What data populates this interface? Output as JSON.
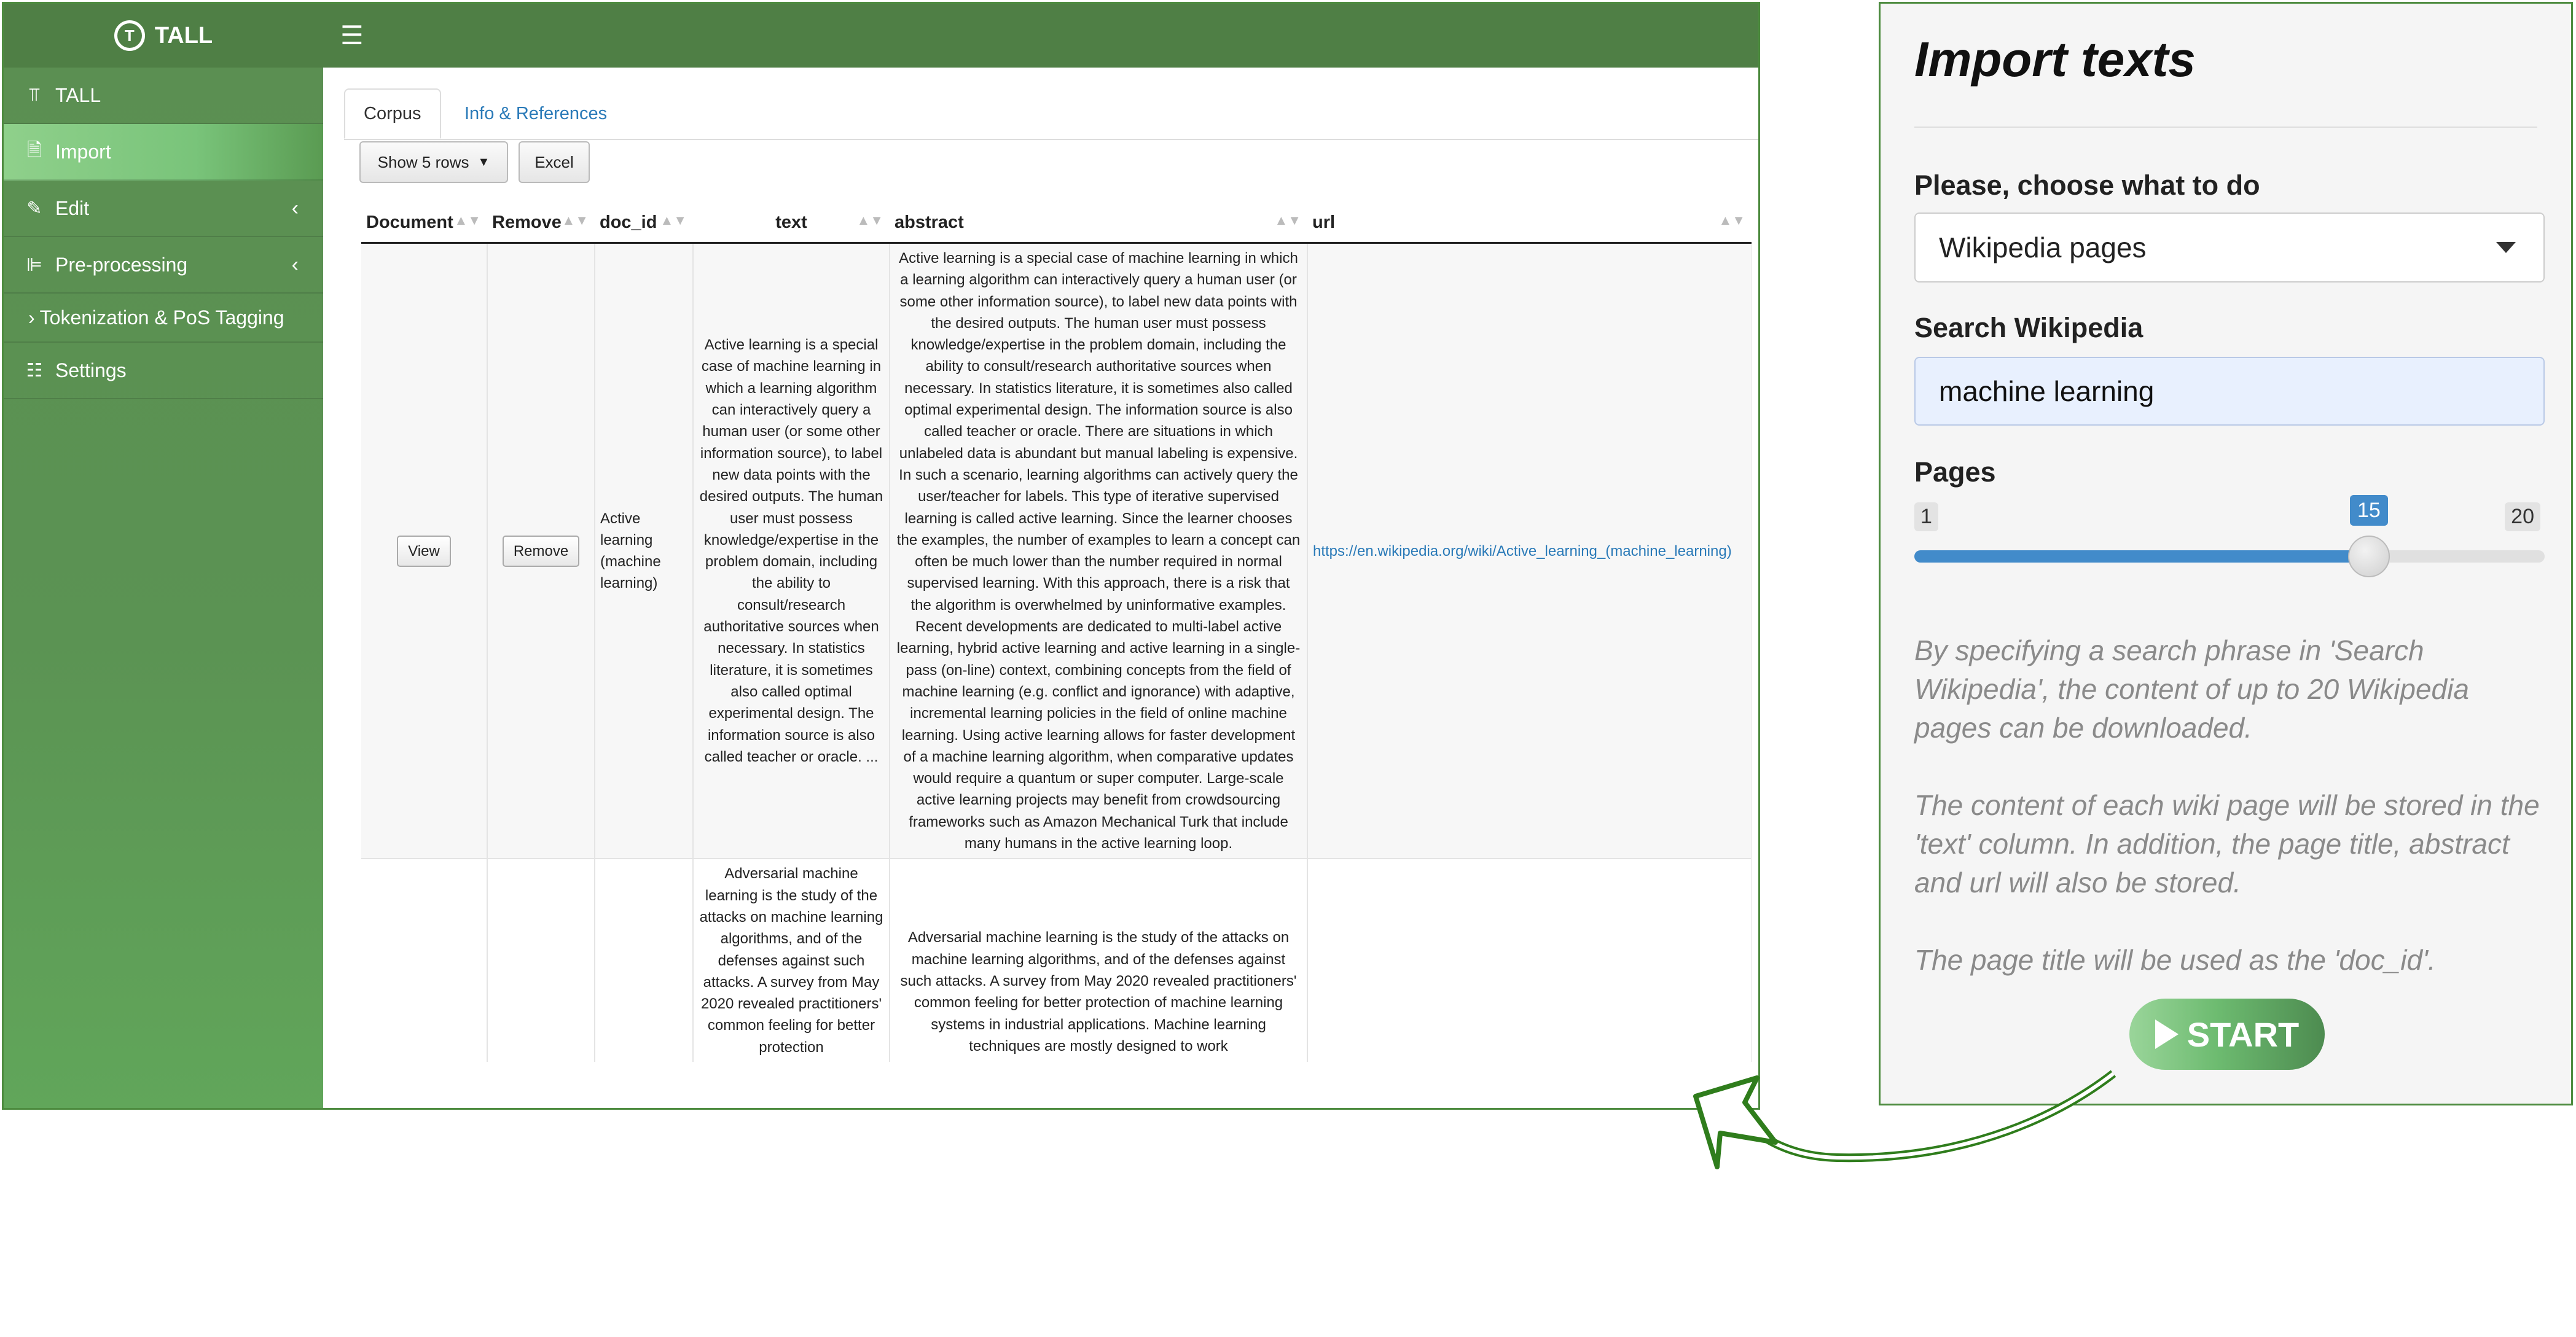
{
  "app": {
    "brand": "TALL",
    "brand_logo_letter": "T",
    "menu_icon": "hamburger-icon",
    "sidebar": [
      {
        "label": "TALL",
        "icon": "text-height-icon",
        "glyph": "ꟷT"
      },
      {
        "label": "Import",
        "icon": "file-import-icon",
        "active": true
      },
      {
        "label": "Edit",
        "icon": "edit-icon",
        "chevron": true
      },
      {
        "label": "Pre-processing",
        "icon": "sliders-icon",
        "chevron": true
      },
      {
        "label": "Tokenization & PoS Tagging",
        "icon": "chevron-right-icon"
      },
      {
        "label": "Settings",
        "icon": "list-check-icon"
      }
    ],
    "tabs": [
      "Corpus",
      "Info & References"
    ],
    "toolbar": {
      "rows_label": "Show 5 rows",
      "excel_label": "Excel"
    },
    "table": {
      "columns": [
        "Document",
        "Remove",
        "doc_id",
        "text",
        "abstract",
        "url"
      ],
      "rows": [
        {
          "view_label": "View",
          "remove_label": "Remove",
          "doc_id": "Active learning (machine learning)",
          "text": "Active learning is a special case of machine learning in which a learning algorithm can interactively query a human user (or some other information source), to label new data points with the desired outputs. The human user must possess knowledge/expertise in the problem domain, including the ability to consult/research authoritative sources when necessary. In statistics literature, it is sometimes also called optimal experimental design. The information source is also called teacher or oracle. ...",
          "abstract": "Active learning is a special case of machine learning in which a learning algorithm can interactively query a human user (or some other information source), to label new data points with the desired outputs. The human user must possess knowledge/expertise in the problem domain, including the ability to consult/research authoritative sources when necessary. In statistics literature, it is sometimes also called optimal experimental design. The information source is also called teacher or oracle. There are situations in which unlabeled data is abundant but manual labeling is expensive. In such a scenario, learning algorithms can actively query the user/teacher for labels. This type of iterative supervised learning is called active learning. Since the learner chooses the examples, the number of examples to learn a concept can often be much lower than the number required in normal supervised learning. With this approach, there is a risk that the algorithm is overwhelmed by uninformative examples. Recent developments are dedicated to multi-label active learning, hybrid active learning and active learning in a single-pass (on-line) context, combining concepts from the field of machine learning (e.g. conflict and ignorance) with adaptive, incremental learning policies in the field of online machine learning. Using active learning allows for faster development of a machine learning algorithm, when comparative updates would require a quantum or super computer. Large-scale active learning projects may benefit from crowdsourcing frameworks such as Amazon Mechanical Turk that include many humans in the active learning loop.",
          "url": "https://en.wikipedia.org/wiki/Active_learning_(machine_learning)"
        },
        {
          "view_label": "",
          "remove_label": "",
          "doc_id": "",
          "text": "Adversarial machine learning is the study of the attacks on machine learning algorithms, and of the defenses against such attacks. A survey from May 2020 revealed practitioners' common feeling for better protection",
          "abstract": "Adversarial machine learning is the study of the attacks on machine learning algorithms, and of the defenses against such attacks. A survey from May 2020 revealed practitioners' common feeling for better protection of machine learning systems in industrial applications. Machine learning techniques are mostly designed to work",
          "url": ""
        }
      ]
    }
  },
  "panel": {
    "title": "Import texts",
    "choose_label": "Please, choose what to do",
    "choose_value": "Wikipedia pages",
    "search_label": "Search Wikipedia",
    "search_value": "machine learning",
    "pages_label": "Pages",
    "slider": {
      "min": 1,
      "max": 20,
      "value": 15
    },
    "help": [
      "By specifying a search phrase in 'Search Wikipedia', the content of up to 20 Wikipedia pages can be downloaded.",
      "The content of each wiki page will be stored in the 'text' column. In addition, the page title, abstract and url will also be stored.",
      "The page title will be used as the 'doc_id'."
    ],
    "start_label": "START"
  },
  "colors": {
    "topbar": "#4f7f45",
    "accent": "#4d8b3f",
    "link": "#2a7ab8",
    "slider": "#428bca"
  }
}
